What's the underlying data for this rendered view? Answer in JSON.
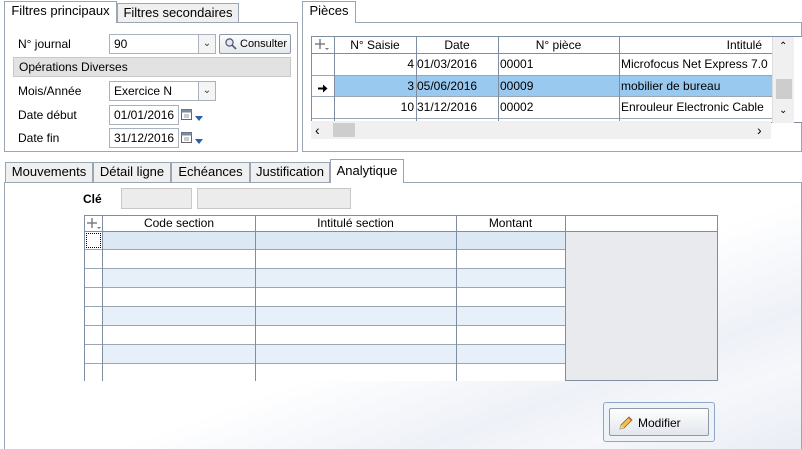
{
  "filter_tabs": [
    "Filtres principaux",
    "Filtres secondaires"
  ],
  "filters": {
    "journal_label": "N° journal",
    "journal_value": "90",
    "consult_label": "Consulter",
    "journal_name": "Opérations Diverses",
    "period_label": "Mois/Année",
    "period_value": "Exercice N",
    "start_label": "Date début",
    "start_value": "01/01/2016",
    "end_label": "Date fin",
    "end_value": "31/12/2016"
  },
  "pieces": {
    "tab_label": "Pièces",
    "columns": [
      "N° Saisie",
      "Date",
      "N° pièce",
      "Intitulé"
    ],
    "rows": [
      {
        "saisie": "4",
        "date": "01/03/2016",
        "piece": "00001",
        "intitule": "Microfocus Net Express 7.0"
      },
      {
        "saisie": "3",
        "date": "05/06/2016",
        "piece": "00009",
        "intitule": "mobilier de bureau"
      },
      {
        "saisie": "10",
        "date": "31/12/2016",
        "piece": "00002",
        "intitule": "Enrouleur Electronic Cable"
      }
    ],
    "selected_index": 1
  },
  "detail_tabs": [
    "Mouvements",
    "Détail ligne",
    "Echéances",
    "Justification",
    "Analytique"
  ],
  "analytique": {
    "key_label": "Clé",
    "key_value": "",
    "key_desc": "",
    "columns": [
      "Code section",
      "Intitulé section",
      "Montant"
    ],
    "rows": [
      "",
      "",
      "",
      "",
      "",
      "",
      "",
      ""
    ],
    "modify_label": "Modifier"
  },
  "colors": {
    "selected_row": "#99c9ef",
    "alt_row": "#e7f0f8",
    "border": "#9aa6b4"
  }
}
